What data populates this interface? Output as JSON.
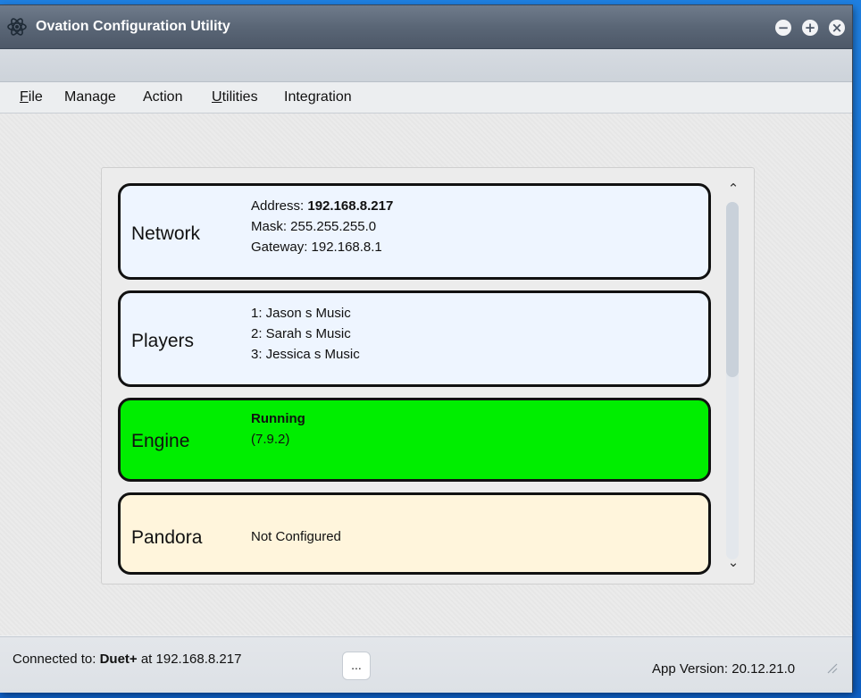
{
  "window": {
    "title": "Ovation Configuration Utility",
    "controls": {
      "minimize": "−",
      "maximize": "+",
      "close": "×"
    }
  },
  "menu": {
    "items": [
      {
        "label": "File",
        "mnemonic": "F",
        "rest": "ile"
      },
      {
        "label": "Manage"
      },
      {
        "label": "Action"
      },
      {
        "label": "Utilities",
        "mnemonic": "U",
        "rest": "tilities"
      },
      {
        "label": "Integration"
      }
    ]
  },
  "cards": {
    "network": {
      "title": "Network",
      "address_label": "Address: ",
      "address_value": "192.168.8.217",
      "mask": "Mask: 255.255.255.0",
      "gateway": "Gateway: 192.168.8.1",
      "background": "#eef5ff"
    },
    "players": {
      "title": "Players",
      "items": [
        "1: Jason s Music",
        "2: Sarah s Music",
        "3: Jessica s Music"
      ],
      "background": "#eef5ff"
    },
    "engine": {
      "title": "Engine",
      "status": "Running",
      "version": "(7.9.2)",
      "background": "#00ee00"
    },
    "pandora": {
      "title": "Pandora",
      "status": "Not Configured",
      "background": "#fff5dc"
    }
  },
  "scrollbar": {
    "up_icon": "chevron-up",
    "down_icon": "chevron-down",
    "up_glyph": "⌃",
    "down_glyph": "⌄"
  },
  "status": {
    "connected_label": "Connected to: ",
    "device": "Duet+",
    "at_text": " at 192.168.8.217",
    "more_button": "...",
    "app_version": "App Version: 20.12.21.0"
  }
}
